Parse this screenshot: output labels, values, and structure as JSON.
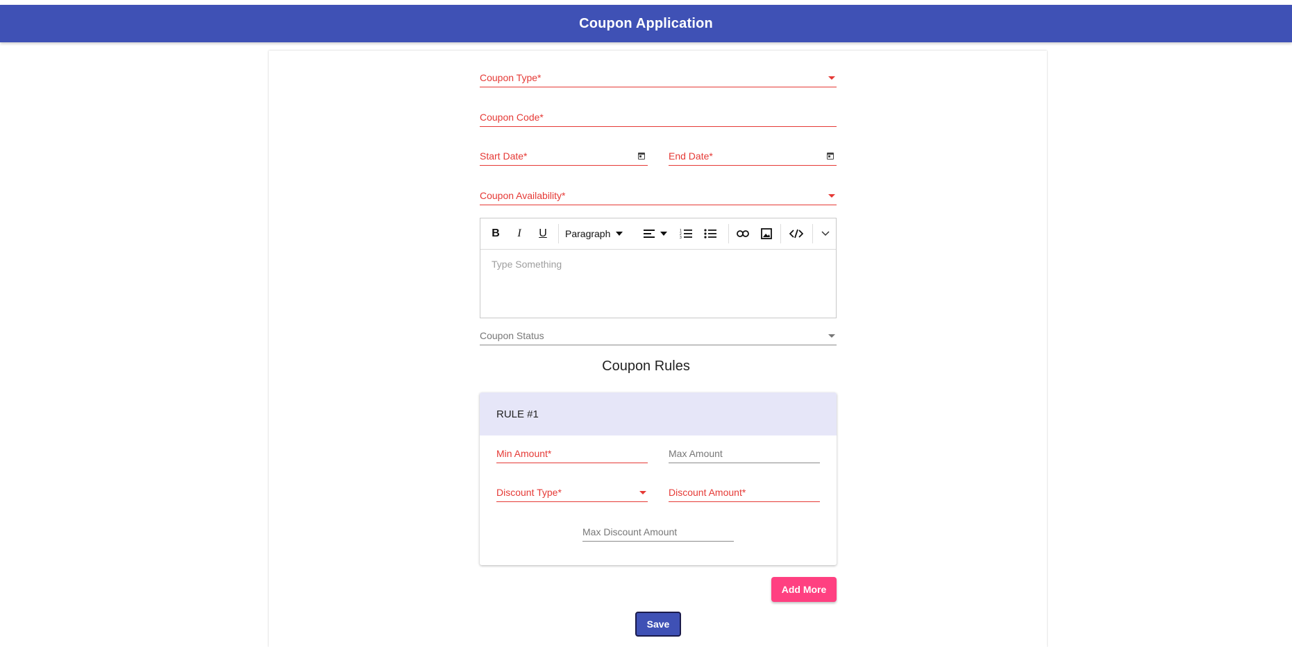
{
  "header": {
    "title": "Coupon Application"
  },
  "form": {
    "coupon_type": "Coupon Type*",
    "coupon_code": "Coupon Code*",
    "start_date": "Start Date*",
    "end_date": "End Date*",
    "coupon_availability": "Coupon Availability*",
    "coupon_status": "Coupon Status"
  },
  "editor": {
    "toolbar": {
      "bold": "B",
      "italic": "I",
      "underline": "U",
      "block_format": "Paragraph"
    },
    "placeholder": "Type Something"
  },
  "rules": {
    "title": "Coupon Rules",
    "items": [
      {
        "heading": "RULE #1",
        "min_amount": "Min Amount*",
        "max_amount": "Max Amount",
        "discount_type": "Discount Type*",
        "discount_amount": "Discount Amount*",
        "max_discount_amount": "Max Discount Amount"
      }
    ]
  },
  "buttons": {
    "add_more": "Add More",
    "save": "Save"
  },
  "colors": {
    "primary": "#3f51b5",
    "accent": "#ff4081",
    "error": "#e53935",
    "rule_header": "#e6e6f8"
  }
}
